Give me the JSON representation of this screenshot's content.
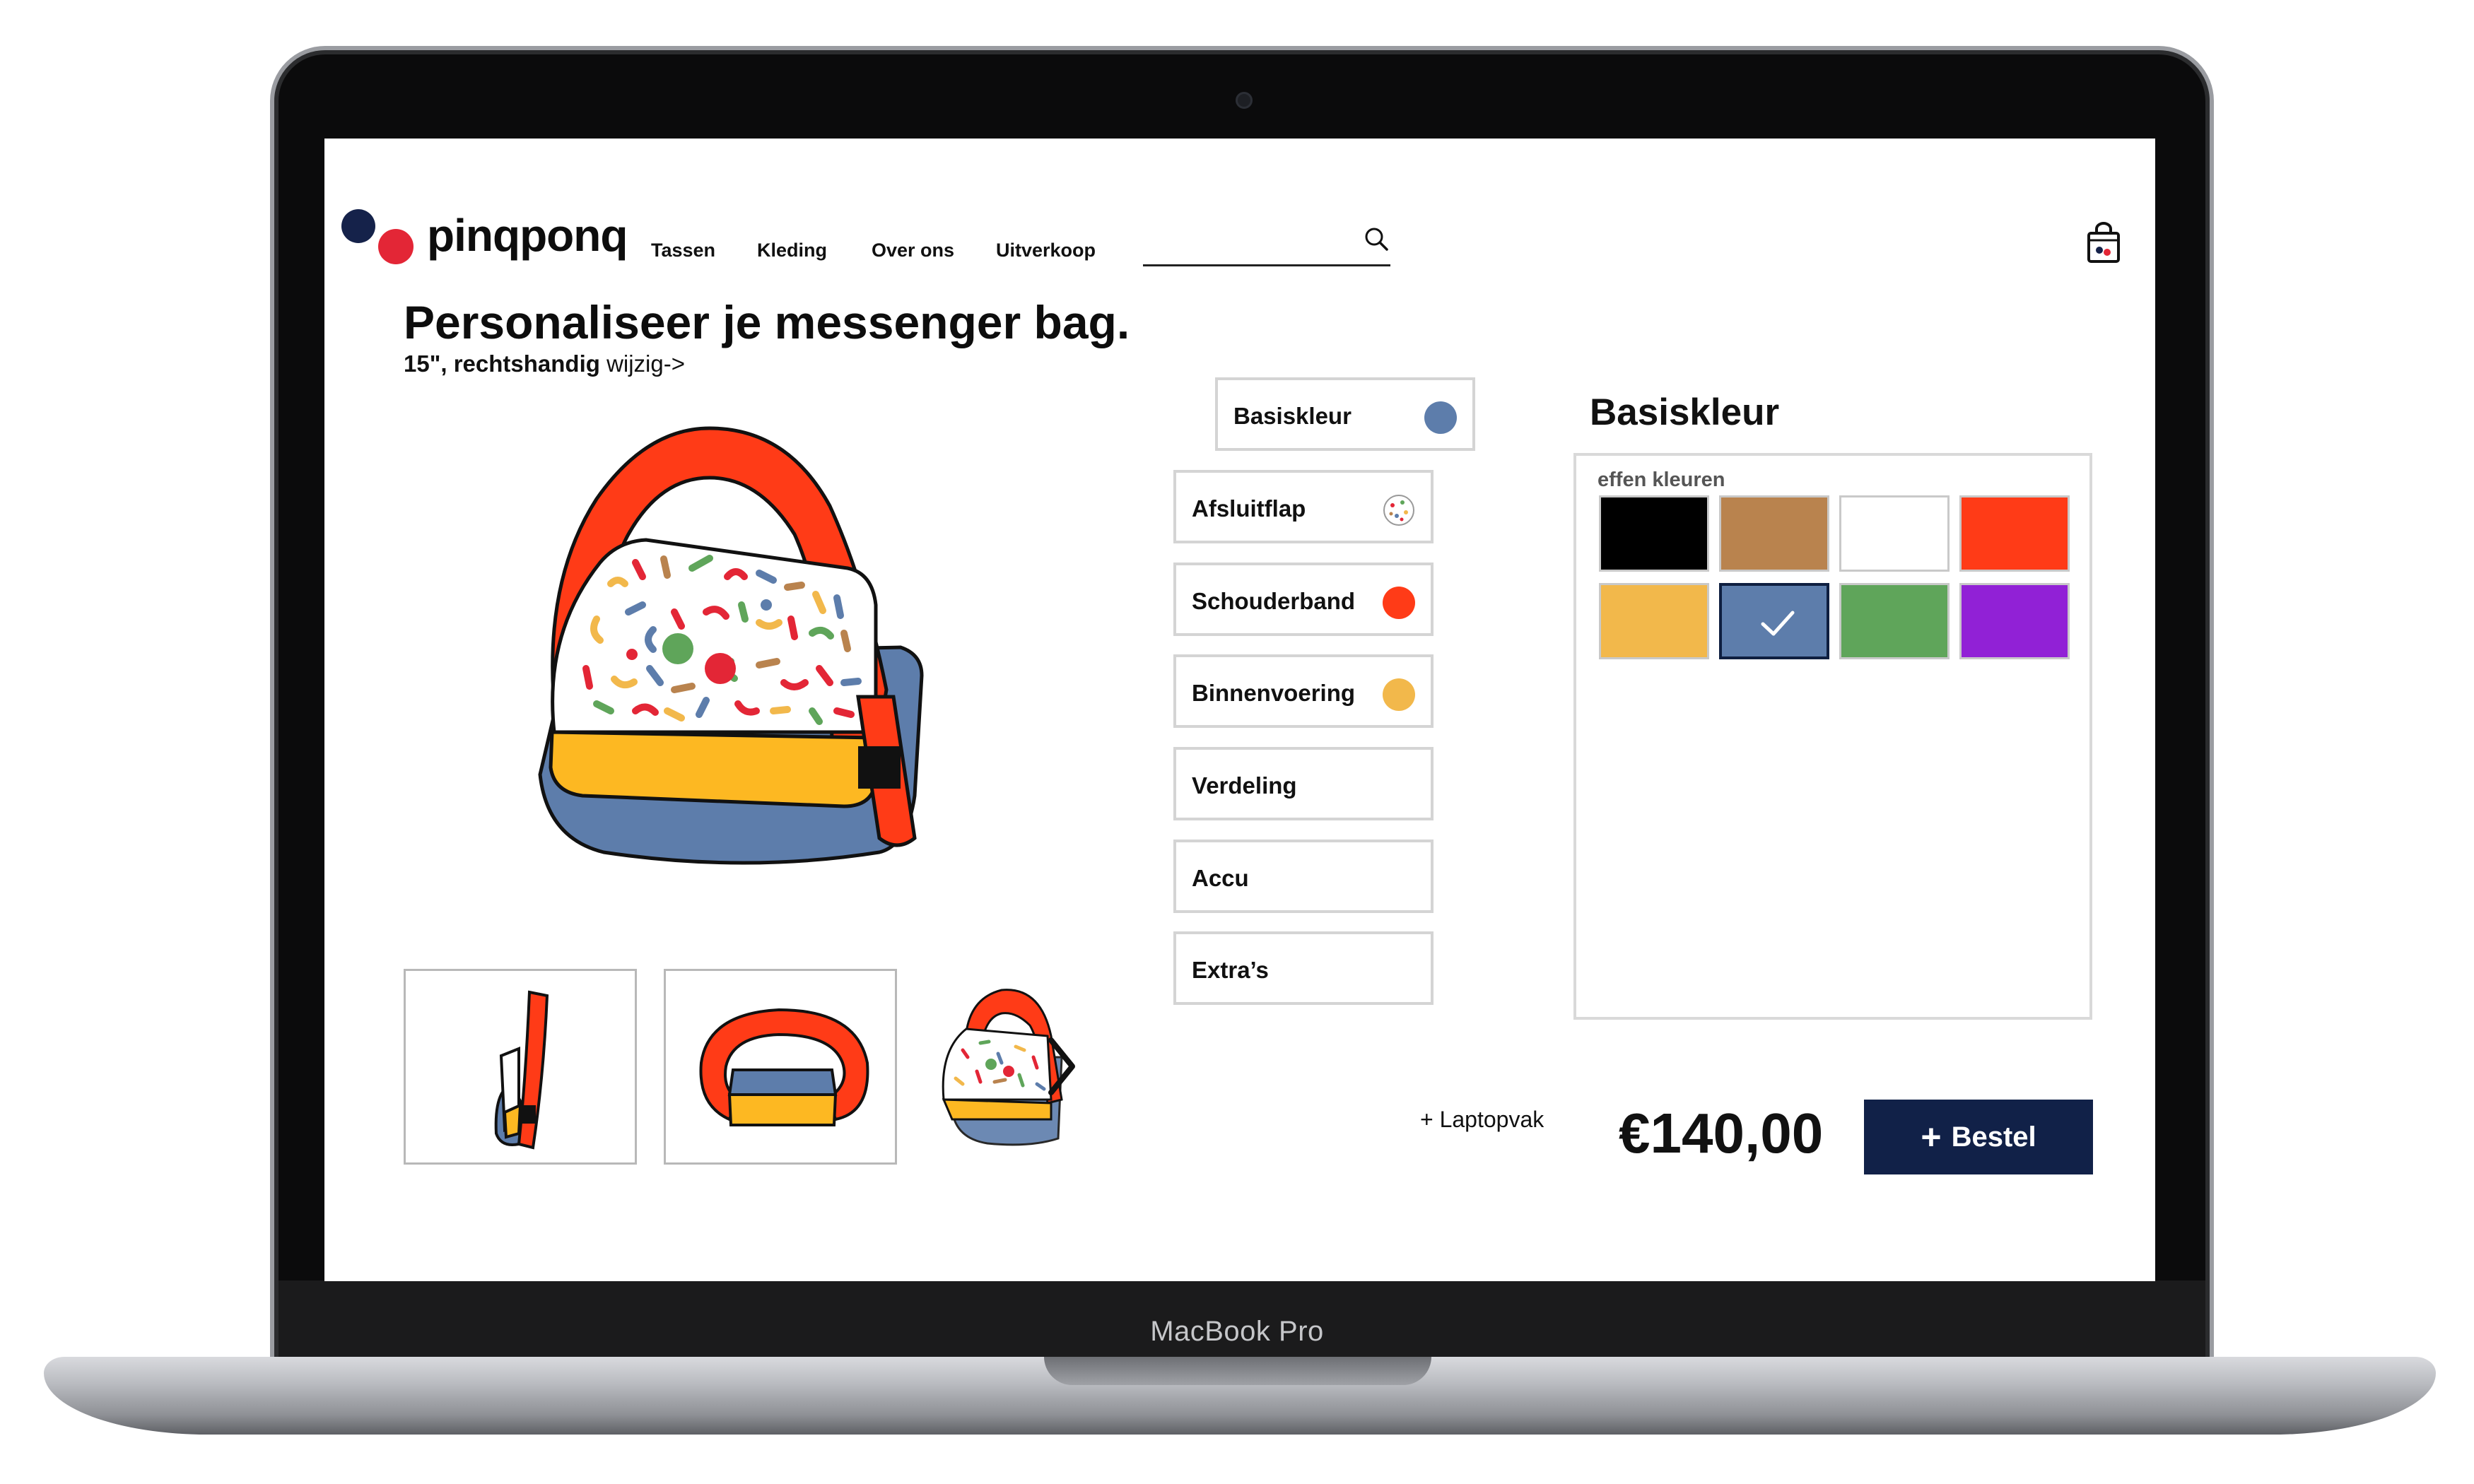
{
  "device": {
    "label": "MacBook Pro"
  },
  "header": {
    "logo": "pinqponq",
    "nav": [
      "Tassen",
      "Kleding",
      "Over ons",
      "Uitverkoop"
    ],
    "search_placeholder": ""
  },
  "product": {
    "title": "Personaliseer je messenger bag.",
    "subtitle_bold": "15\", rechtshandig",
    "edit_link": "wijzig->"
  },
  "options": [
    {
      "label": "Basiskleur",
      "color": "#5d7dab"
    },
    {
      "label": "Afsluitflap",
      "color": "pattern"
    },
    {
      "label": "Schouderband",
      "color": "#ff3b17"
    },
    {
      "label": "Binnenvoering",
      "color": "#f2b84b"
    },
    {
      "label": "Verdeling",
      "color": ""
    },
    {
      "label": "Accu",
      "color": ""
    },
    {
      "label": "Extra’s",
      "color": ""
    }
  ],
  "panel": {
    "title": "Basiskleur",
    "subtitle": "effen kleuren",
    "swatches": [
      "#000000",
      "#b9834e",
      "#ffffff",
      "#ff3b17",
      "#f2b84b",
      "#5d7dab",
      "#5fa55a",
      "#9121d6"
    ],
    "selected_index": 5
  },
  "footer": {
    "addon": "+ Laptopvak",
    "price": "€140,00",
    "order_label": "Bestel"
  },
  "colors": {
    "navy": "#112148",
    "red": "#e32636",
    "border": "#d4d4d4"
  },
  "icons": [
    "search-icon",
    "cart-icon",
    "chevron-right-icon",
    "check-icon",
    "plus-icon"
  ]
}
